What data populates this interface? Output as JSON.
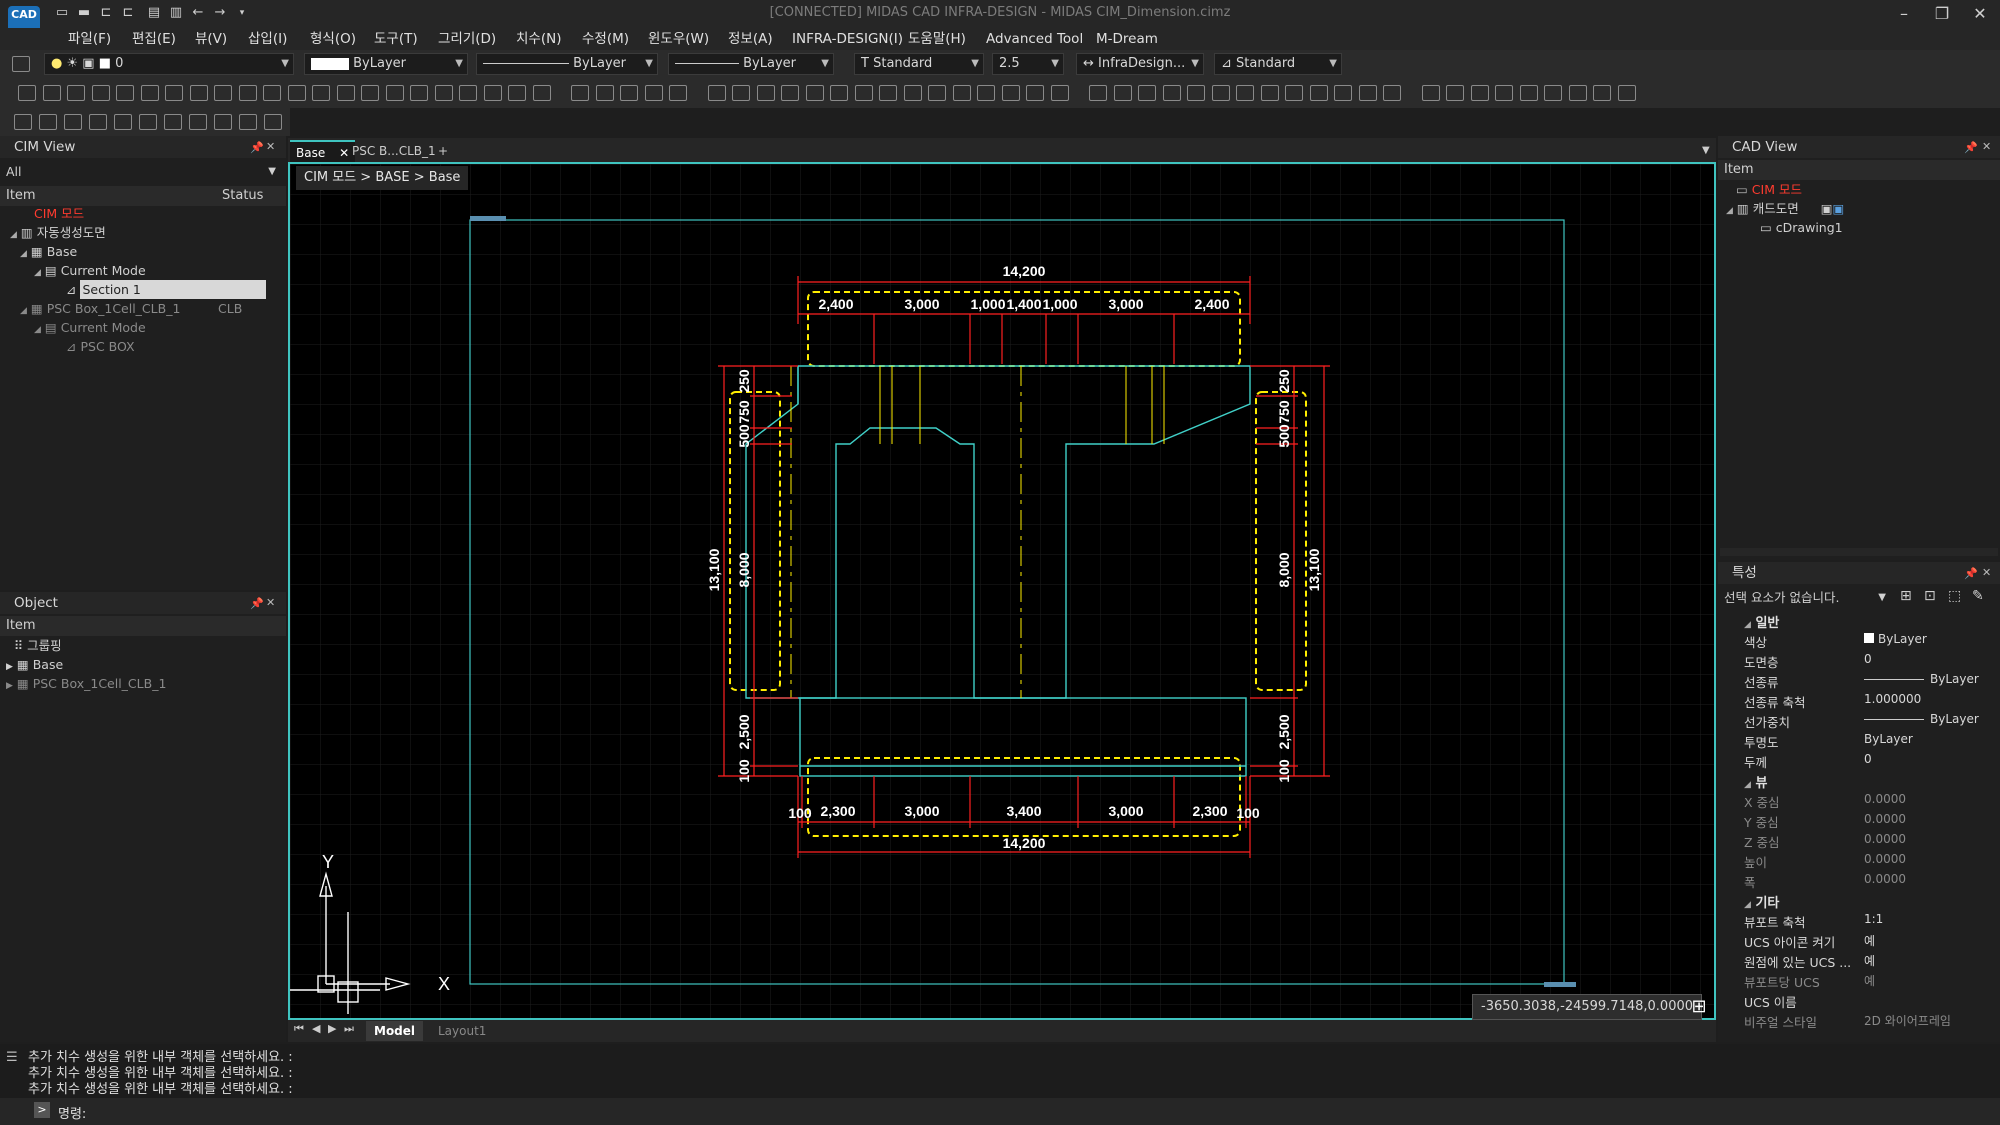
{
  "app": {
    "title": "[CONNECTED] MIDAS CAD INFRA-DESIGN - MIDAS CIM_Dimension.cimz",
    "logo": "CAD"
  },
  "menu": [
    "파일(F)",
    "편집(E)",
    "뷰(V)",
    "삽입(I)",
    "형식(O)",
    "도구(T)",
    "그리기(D)",
    "치수(N)",
    "수정(M)",
    "윈도우(W)",
    "정보(A)",
    "INFRA-DESIGN(I)",
    "도움말(H)",
    "Advanced Tool",
    "M-Dream"
  ],
  "toolbar": {
    "layer_value": "0",
    "color_value": "ByLayer",
    "linetype_value": "ByLayer",
    "lineweight_value": "ByLayer",
    "textstyle_value": "Standard",
    "textsize_value": "2.5",
    "dimstyle_value": "InfraDesign...",
    "tablestyle_value": "Standard"
  },
  "cim_view": {
    "title": "CIM View",
    "filter": "All",
    "col_item": "Item",
    "col_status": "Status",
    "items": [
      {
        "label": "CIM 모드"
      },
      {
        "label": "자동생성도면"
      },
      {
        "label": "Base"
      },
      {
        "label": "Current Mode"
      },
      {
        "label": "Section 1"
      },
      {
        "label": "PSC Box_1Cell_CLB_1",
        "status": "CLB"
      },
      {
        "label": "Current Mode"
      },
      {
        "label": "PSC BOX"
      }
    ]
  },
  "object_panel": {
    "title": "Object",
    "col_item": "Item",
    "items": [
      {
        "label": "그룹핑"
      },
      {
        "label": "Base"
      },
      {
        "label": "PSC Box_1Cell_CLB_1"
      }
    ]
  },
  "doc_tabs": [
    "Base",
    "PSC B...CLB_1",
    "+"
  ],
  "breadcrumb": "CIM 모드 > BASE > Base",
  "drawing": {
    "top_total": "14,200",
    "top_dims": [
      "2,400",
      "3,000",
      "1,000",
      "1,400",
      "1,000",
      "3,000",
      "2,400"
    ],
    "bottom_total": "14,200",
    "bottom_dims": [
      "100",
      "2,300",
      "3,000",
      "3,400",
      "3,000",
      "2,300",
      "100"
    ],
    "left_total": "13,100",
    "left_dims": [
      "250",
      "750",
      "500",
      "8,000",
      "2,500",
      "100"
    ],
    "right_total": "13,100",
    "right_dims": [
      "250",
      "750",
      "500",
      "8,000",
      "2,500",
      "100"
    ],
    "ucs_x": "X",
    "ucs_y": "Y"
  },
  "coords": "-3650.3038,-24599.7148,0.0000",
  "layout_tabs": [
    "Model",
    "Layout1"
  ],
  "command": {
    "history": [
      "추가 치수 생성을 위한 내부 객체를 선택하세요. :",
      "추가 치수 생성을 위한 내부 객체를 선택하세요. :",
      "추가 치수 생성을 위한 내부 객체를 선택하세요. :"
    ],
    "prompt": "명령:"
  },
  "cad_view": {
    "title": "CAD View",
    "col_item": "Item",
    "items": [
      {
        "label": "CIM 모드"
      },
      {
        "label": "캐드도면"
      },
      {
        "label": "cDrawing1"
      }
    ]
  },
  "properties": {
    "title": "특성",
    "selection": "선택 요소가 없습니다.",
    "sections": {
      "general": "일반",
      "view": "뷰",
      "misc": "기타"
    },
    "general": [
      {
        "key": "색상",
        "value": "ByLayer"
      },
      {
        "key": "도면층",
        "value": "0"
      },
      {
        "key": "선종류",
        "value": "ByLayer"
      },
      {
        "key": "선종류 축척",
        "value": "1.000000"
      },
      {
        "key": "선가중치",
        "value": "ByLayer"
      },
      {
        "key": "투명도",
        "value": "ByLayer"
      },
      {
        "key": "두께",
        "value": "0"
      }
    ],
    "view": [
      {
        "key": "X 중심",
        "value": "0.0000"
      },
      {
        "key": "Y 중심",
        "value": "0.0000"
      },
      {
        "key": "Z 중심",
        "value": "0.0000"
      },
      {
        "key": "높이",
        "value": "0.0000"
      },
      {
        "key": "폭",
        "value": "0.0000"
      }
    ],
    "misc": [
      {
        "key": "뷰포트 축척",
        "value": "1:1"
      },
      {
        "key": "UCS 아이콘 켜기",
        "value": "예"
      },
      {
        "key": "원점에 있는 UCS ...",
        "value": "예"
      },
      {
        "key": "뷰포트당 UCS",
        "value": "예"
      },
      {
        "key": "UCS 이름",
        "value": ""
      },
      {
        "key": "비주얼 스타일",
        "value": "2D 와이어프레임"
      }
    ]
  },
  "colors": {
    "accent": "#3fc4c0",
    "dim_red": "#ff2020",
    "highlight_yellow": "#ffee00",
    "section_cyan": "#40d0c8"
  }
}
